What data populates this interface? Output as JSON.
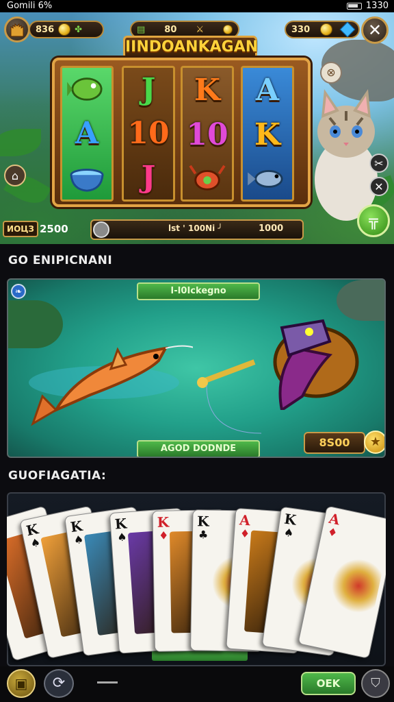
{
  "status": {
    "left_text": "Gomili 6%",
    "time": "1330"
  },
  "top_hud": {
    "coins_left": "836",
    "coins_mid": "80",
    "coins_right": "330"
  },
  "game": {
    "title": "IINDOANKAGAN",
    "reels": [
      {
        "symbols": [
          "fish-icon",
          "A",
          "bowl-icon"
        ]
      },
      {
        "symbols": [
          "J",
          "10",
          "J"
        ]
      },
      {
        "symbols": [
          "K",
          "10",
          "crab-icon"
        ]
      },
      {
        "symbols": [
          "A",
          "K",
          "fish2-icon"
        ]
      }
    ],
    "bet_label": "ИОЦЗ",
    "bet_value": "2500",
    "spin_text": "lst ' 100Ni ╯",
    "spin_value": "1000",
    "green_button": "╦",
    "colors": {
      "accent": "#e3a445",
      "reel_green": "#22c04a"
    }
  },
  "section_fishing": {
    "title": "GO ENIPICNANI",
    "top_pill": "I-I0Ickegno",
    "bottom_pill": "AGOD DODNDE",
    "score": "8S00"
  },
  "section_cards": {
    "title": "GUOFIAGATIA:",
    "cards": [
      {
        "rank": "K",
        "suit": "♦",
        "color": "red"
      },
      {
        "rank": "K",
        "suit": "♠",
        "color": "blk"
      },
      {
        "rank": "K",
        "suit": "♠",
        "color": "blk"
      },
      {
        "rank": "K",
        "suit": "♠",
        "color": "blk"
      },
      {
        "rank": "K",
        "suit": "♦",
        "color": "red"
      },
      {
        "rank": "K",
        "suit": "♣",
        "color": "blk"
      },
      {
        "rank": "A",
        "suit": "♦",
        "color": "red"
      },
      {
        "rank": "K",
        "suit": "♠",
        "color": "blk"
      },
      {
        "rank": "A",
        "suit": "♦",
        "color": "red"
      }
    ]
  },
  "bottom_bar": {
    "ok_label": "OEK"
  }
}
